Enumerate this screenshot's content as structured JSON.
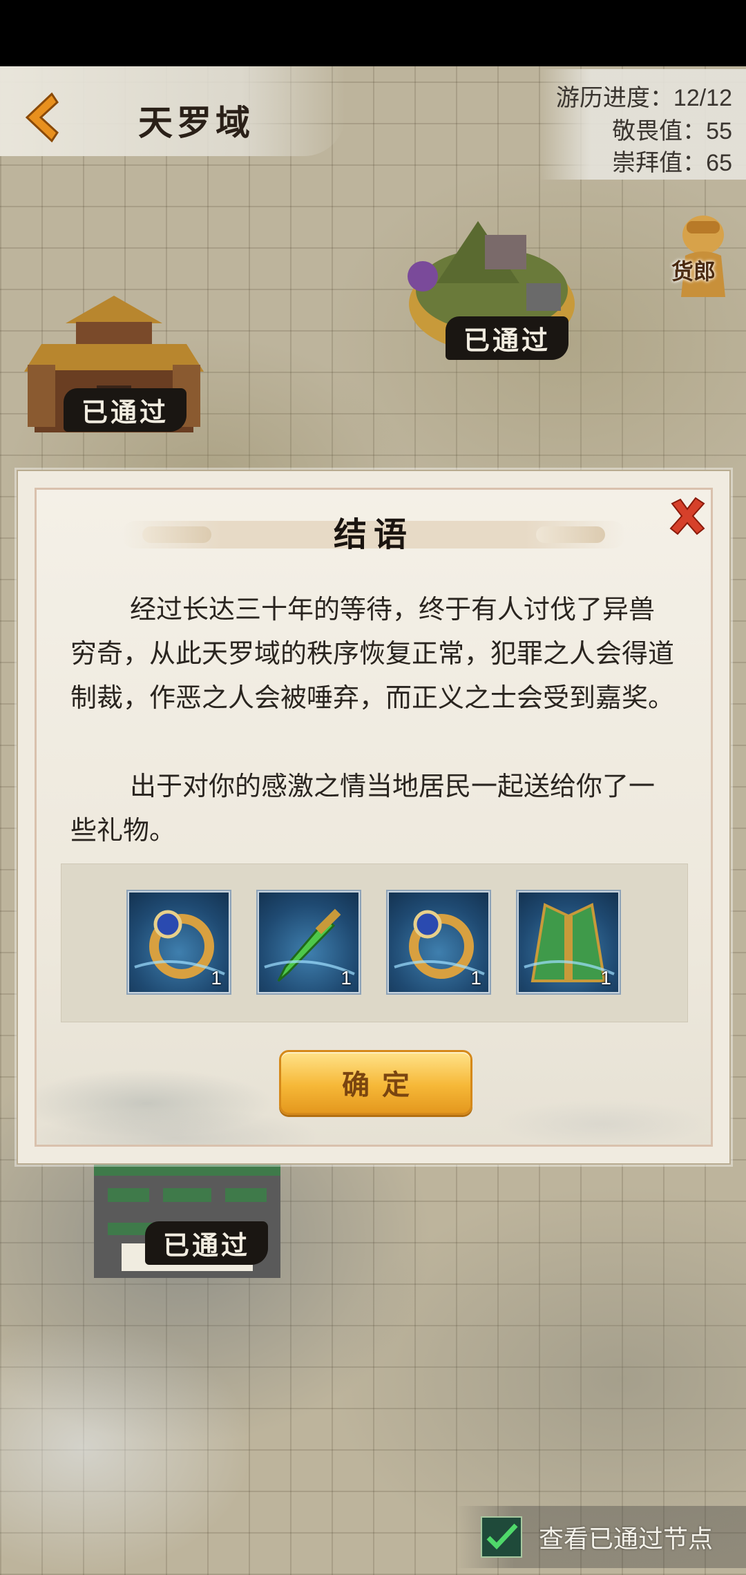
{
  "header": {
    "title": "天罗域",
    "stats": [
      {
        "label": "游历进度：",
        "value": "12/12"
      },
      {
        "label": "敬畏值：",
        "value": "55"
      },
      {
        "label": "崇拜值：",
        "value": "65"
      }
    ]
  },
  "merchant": {
    "label": "货郎"
  },
  "map_nodes": [
    {
      "status": "已通过"
    },
    {
      "status": "已通过"
    },
    {
      "status": "已通过"
    }
  ],
  "dialog": {
    "title": "结语",
    "paragraphs": [
      "经过长达三十年的等待，终于有人讨伐了异兽穷奇，从此天罗域的秩序恢复正常，犯罪之人会得道制裁，作恶之人会被唾弃，而正义之士会受到嘉奖。",
      "出于对你的感激之情当地居民一起送给你了一些礼物。"
    ],
    "rewards": [
      {
        "icon": "ring-icon",
        "count": "1"
      },
      {
        "icon": "sword-icon",
        "count": "1"
      },
      {
        "icon": "ring-icon",
        "count": "1"
      },
      {
        "icon": "robe-icon",
        "count": "1"
      }
    ],
    "confirm_label": "确定"
  },
  "footer": {
    "toggle_label": "查看已通过节点",
    "toggle_checked": true
  },
  "colors": {
    "accent": "#f6b838",
    "close": "#d6402a",
    "node_label_bg": "#1a1612"
  }
}
